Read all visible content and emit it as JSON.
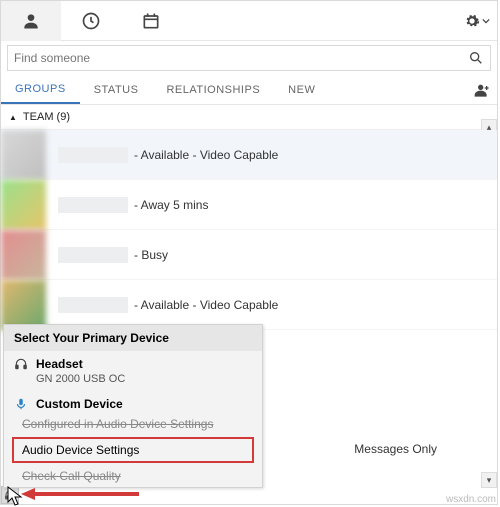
{
  "search": {
    "placeholder": "Find someone"
  },
  "navtabs": {
    "groups": "GROUPS",
    "status": "STATUS",
    "relationships": "RELATIONSHIPS",
    "new": "NEW"
  },
  "section": {
    "team_label": "TEAM (9)"
  },
  "contacts": {
    "c1_status": "- Available - Video Capable",
    "c2_status": "- Away 5 mins",
    "c3_status": "- Busy",
    "c4_status": "- Available - Video Capable"
  },
  "popup": {
    "title": "Select Your Primary Device",
    "headset_label": "Headset",
    "headset_sub": "GN 2000 USB OC",
    "custom_label": "Custom Device",
    "custom_sub": "Configured in Audio Device Settings",
    "audio_settings": "Audio Device Settings",
    "check_call": "Check Call Quality"
  },
  "msg_only": "Messages Only",
  "watermark": "wsxdn.com"
}
